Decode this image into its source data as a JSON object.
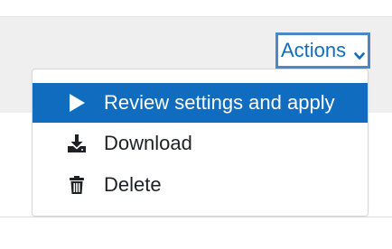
{
  "actions_button": {
    "label": "Actions",
    "icon": "chevron-down-icon",
    "accent_color": "#0f6cbf"
  },
  "menu": {
    "items": [
      {
        "label": "Review settings and apply",
        "icon": "play-icon",
        "active": true
      },
      {
        "label": "Download",
        "icon": "download-icon",
        "active": false
      },
      {
        "label": "Delete",
        "icon": "trash-icon",
        "active": false
      }
    ]
  }
}
